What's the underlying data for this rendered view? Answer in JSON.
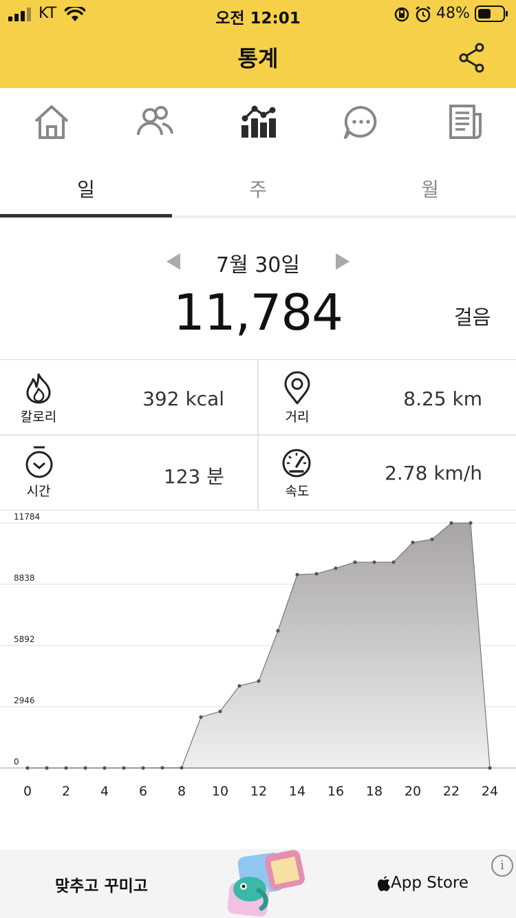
{
  "status_bar": {
    "carrier": "KT",
    "time": "오전 12:01",
    "battery": "48%"
  },
  "header": {
    "title": "통계"
  },
  "nav": {
    "items": [
      {
        "icon": "home-icon"
      },
      {
        "icon": "friends-icon"
      },
      {
        "icon": "stats-icon"
      },
      {
        "icon": "chat-icon"
      },
      {
        "icon": "news-icon"
      }
    ]
  },
  "tabs": [
    {
      "label": "일",
      "active": true
    },
    {
      "label": "주",
      "active": false
    },
    {
      "label": "월",
      "active": false
    }
  ],
  "summary": {
    "date": "7월 30일",
    "steps": "11,784",
    "steps_unit": "걸음"
  },
  "stats": [
    {
      "label": "칼로리",
      "value": "392 kcal",
      "icon": "flame-icon"
    },
    {
      "label": "거리",
      "value": "8.25 km",
      "icon": "location-pin-icon"
    },
    {
      "label": "시간",
      "value": "123 분",
      "icon": "stopwatch-icon"
    },
    {
      "label": "속도",
      "value": "2.78 km/h",
      "icon": "speedometer-icon"
    }
  ],
  "chart_data": {
    "type": "area",
    "x": [
      0,
      1,
      2,
      3,
      4,
      5,
      6,
      7,
      8,
      9,
      10,
      11,
      12,
      13,
      14,
      15,
      16,
      17,
      18,
      19,
      20,
      21,
      22,
      23,
      24
    ],
    "values": [
      0,
      0,
      0,
      0,
      0,
      0,
      0,
      10,
      10,
      2450,
      2720,
      3950,
      4180,
      6600,
      9300,
      9340,
      9610,
      9900,
      9900,
      9900,
      10850,
      11000,
      11784,
      11784,
      0
    ],
    "xticks": [
      "0",
      "2",
      "4",
      "6",
      "8",
      "10",
      "12",
      "14",
      "16",
      "18",
      "20",
      "22",
      "24"
    ],
    "yticks": [
      "0",
      "2946",
      "5892",
      "8838",
      "11784"
    ],
    "ylim": [
      0,
      11784
    ],
    "xlim": [
      0,
      24
    ],
    "grid": true,
    "colors": {
      "fill_top": "#a8a4a4",
      "fill_bottom": "#f0eff0",
      "line": "#777777",
      "point": "#555555"
    }
  },
  "ad": {
    "text": "맞추고 꾸미고",
    "store": "App Store",
    "info": "i"
  },
  "colors": {
    "header_bg": "#f6d049",
    "tab_active": "#333333",
    "tab_inactive": "#888888"
  }
}
